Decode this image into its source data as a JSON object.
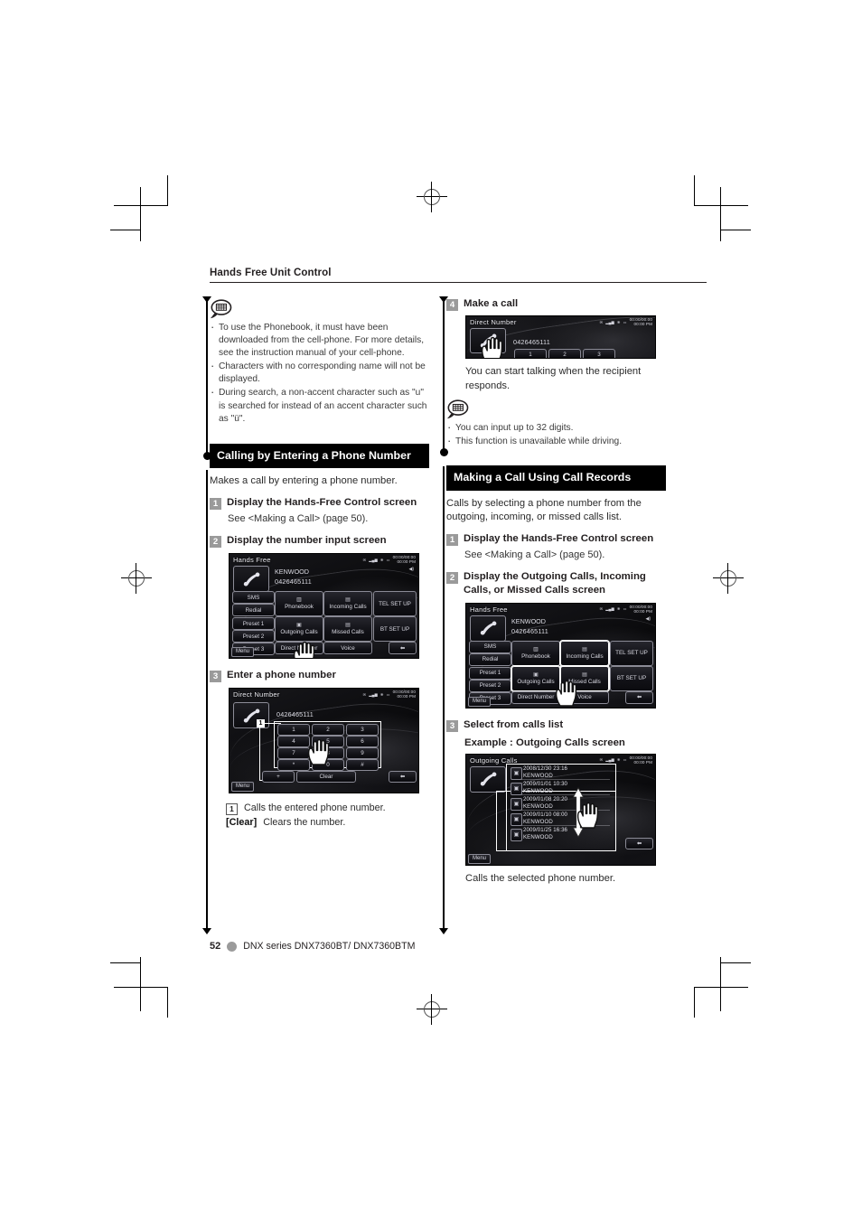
{
  "running_head": "Hands Free Unit Control",
  "left_column": {
    "note_top": {
      "icon": "note-bubble-icon",
      "items": [
        "To use the Phonebook, it must have been downloaded from the cell-phone. For more details, see the instruction manual of your cell-phone.",
        "Characters with no corresponding name will not be displayed.",
        "During search, a non-accent character such as \"u\" is searched for instead of an accent character such as \"ü\"."
      ]
    },
    "section": {
      "title": "Calling by Entering a Phone Number",
      "lead": "Makes a call by entering a phone number.",
      "steps": [
        {
          "num": "1",
          "title": "Display the Hands-Free Control screen",
          "sub": "See <Making a Call> (page 50)."
        },
        {
          "num": "2",
          "title": "Display the number input screen"
        },
        {
          "num": "3",
          "title": "Enter a phone number"
        }
      ],
      "callouts": [
        {
          "num": "1",
          "text": "Calls the entered phone number."
        },
        {
          "key": "[Clear]",
          "text": "Clears the number."
        }
      ]
    }
  },
  "right_column": {
    "step4": {
      "num": "4",
      "title": "Make a call",
      "after": "You can start talking when the recipient responds."
    },
    "note_right": {
      "icon": "note-bubble-icon",
      "items": [
        "You can input up to 32 digits.",
        "This function is unavailable while driving."
      ]
    },
    "section": {
      "title": "Making a Call Using Call Records",
      "lead": "Calls by selecting a phone number from the outgoing, incoming, or missed calls list.",
      "steps": [
        {
          "num": "1",
          "title": "Display the Hands-Free Control screen",
          "sub": "See <Making a Call> (page 50)."
        },
        {
          "num": "2",
          "title": "Display the Outgoing Calls, Incoming Calls, or Missed Calls screen"
        },
        {
          "num": "3",
          "title": "Select from calls list",
          "sub2": "Example : Outgoing Calls screen"
        }
      ],
      "after": "Calls the selected phone number."
    }
  },
  "device_screens": {
    "hands_free": {
      "title": "Hands Free",
      "clock": "00:00/00:00",
      "clock2": "00:00 PM",
      "contact_name": "KENWOOD",
      "contact_number": "0426465111",
      "left_keys": [
        "SMS",
        "Redial",
        "Preset 1",
        "Preset 2",
        "Preset 3"
      ],
      "center_keys": [
        "Phonebook",
        "Incoming Calls",
        "Outgoing Calls",
        "Missed Calls",
        "Direct Number",
        "Voice"
      ],
      "right_keys": [
        "TEL SET UP",
        "BT SET UP"
      ],
      "menu": "Menu",
      "back_icon": "back-arrow-icon"
    },
    "direct_number": {
      "title": "Direct Number",
      "clock": "00:00/00:00",
      "clock2": "00:00 PM",
      "number": "0426465111",
      "keypad": [
        "1",
        "2",
        "3",
        "4",
        "5",
        "6",
        "7",
        "8",
        "9",
        "*",
        "0",
        "#"
      ],
      "plus_key": "+",
      "clear_key": "Clear",
      "menu": "Menu",
      "callout_num": "1"
    },
    "make_a_call": {
      "title": "Direct Number",
      "clock": "00:00/00:00",
      "clock2": "00:00 PM",
      "number": "0426465111",
      "visible_keys": [
        "1",
        "2",
        "3"
      ]
    },
    "outgoing_calls": {
      "title": "Outgoing Calls",
      "clock": "00:00/00:00",
      "clock2": "00:00 PM",
      "menu": "Menu",
      "rows": [
        {
          "date": "2008/12/30 23:16",
          "name": "KENWOOD"
        },
        {
          "date": "2009/01/01 10:30",
          "name": "KENWOOD"
        },
        {
          "date": "2009/01/08 20:20",
          "name": "KENWOOD"
        },
        {
          "date": "2009/01/10 08:00",
          "name": "KENWOOD"
        },
        {
          "date": "2009/01/25 16:36",
          "name": "KENWOOD"
        }
      ]
    }
  },
  "footer": {
    "page_number": "52",
    "book": "DNX series   DNX7360BT/ DNX7360BTM"
  },
  "colors": {
    "text": "#231f20",
    "section_bar_bg": "#000000",
    "step_num_bg": "#9a9a9a",
    "footer_dot": "#9b9b9b"
  }
}
